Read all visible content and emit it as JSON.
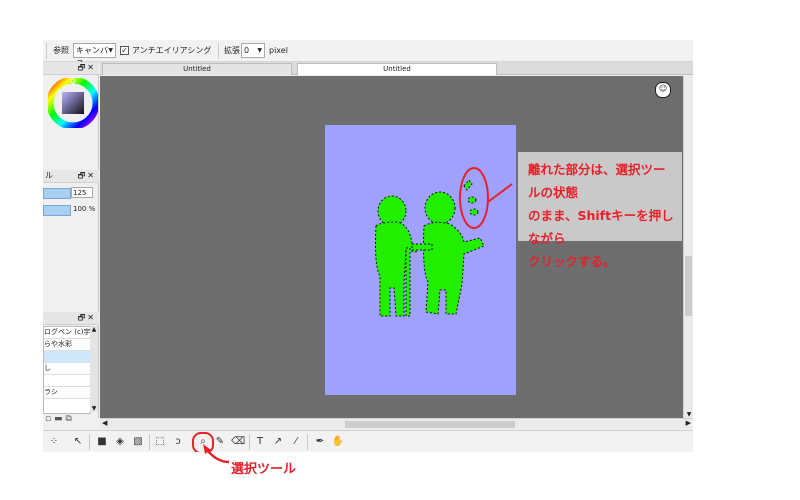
{
  "toolbar": {
    "ref_label": "参照",
    "ref_value": "キャンバス",
    "antialias_label": "アンチエイリアシング",
    "expand_label": "拡張",
    "expand_value": "0",
    "unit_label": "pixel"
  },
  "tabs": [
    "Untitled",
    "Untitled"
  ],
  "panels": {
    "brush_panel_title": "ル",
    "size_value": "125",
    "opacity_value": "100 %",
    "brush_list": [
      "ログペン (c)宇",
      "らや水彩",
      "",
      "し",
      "",
      "ラシ"
    ]
  },
  "callout": {
    "text": "離れた部分は、選択ツールの状態\nのまま、Shiftキーを押しながら\nクリックする。"
  },
  "annotation_label": "選択ツール",
  "colors": {
    "accent": "#e8202a",
    "canvas_bg": "#a0a0ff",
    "selection_fill": "#22ee00",
    "workspace_bg": "#6e6e6e",
    "callout_bg": "#c9c9c9"
  }
}
